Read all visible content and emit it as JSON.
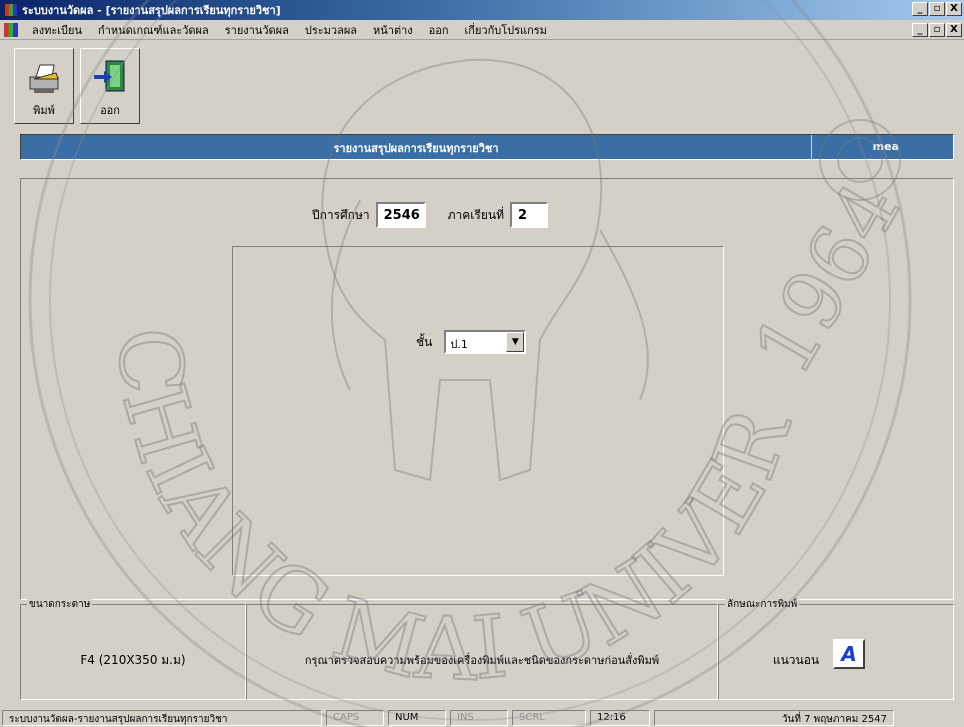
{
  "window": {
    "title": "ระบบงานวัดผล - [รายงานสรุปผลการเรียนทุกรายวิชา]",
    "controls": [
      "_",
      "▫",
      "X"
    ]
  },
  "menu": {
    "items": [
      "ลงทะเบียน",
      "กำหนดเกณฑ์และวัดผล",
      "รายงานวัดผล",
      "ประมวลผล",
      "หน้าต่าง",
      "ออก",
      "เกี่ยวกับโปรแกรม"
    ],
    "controls": [
      "_",
      "▫",
      "X"
    ]
  },
  "toolbar": {
    "print_label": "พิมพ์",
    "exit_label": "ออก"
  },
  "header": {
    "title": "รายงานสรุปผลการเรียนทุกรายวิชา",
    "user": "mea"
  },
  "form": {
    "year_label": "ปีการศึกษา",
    "year_value": "2546",
    "semester_label": "ภาคเรียนที่",
    "semester_value": "2",
    "grade_label": "ชั้น",
    "grade_value": "ป.1"
  },
  "paper_size": {
    "title": "ขนาดกระดาษ",
    "value": "F4 (210X350 ม.ม)"
  },
  "notice": {
    "text": "กรุณาตรวจสอบความพร้อมของเครื่องพิมพ์และชนิดของกระดาษก่อนสั่งพิมพ์"
  },
  "print_style": {
    "title": "ลักษณะการพิมพ์",
    "value": "แนวนอน",
    "icon_letter": "A"
  },
  "status": {
    "message": "ระบบงานวัดผล-รายงานสรุปผลการเรียนทุกรายวิชา",
    "caps": "CAPS",
    "num": "NUM",
    "ins": "INS",
    "scrl": "SCRL",
    "time": "12:16",
    "date": "วันที่ 7 พฤษภาคม 2547"
  },
  "watermark": {
    "text": "CHIANG MAI UNIVERSITY",
    "year": "1964"
  }
}
